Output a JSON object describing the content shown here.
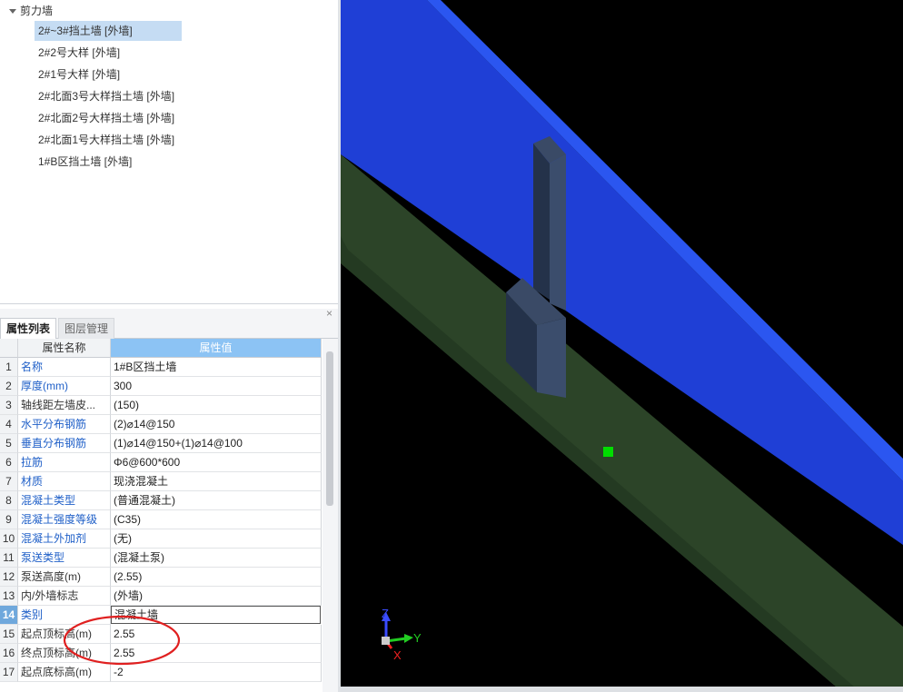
{
  "tree": {
    "root_label": "剪力墙",
    "items": [
      {
        "label": "2#~3#挡土墙 [外墙]",
        "selected": true
      },
      {
        "label": "2#2号大样 [外墙]",
        "selected": false
      },
      {
        "label": "2#1号大样 [外墙]",
        "selected": false
      },
      {
        "label": "2#北面3号大样挡土墙 [外墙]",
        "selected": false
      },
      {
        "label": "2#北面2号大样挡土墙 [外墙]",
        "selected": false
      },
      {
        "label": "2#北面1号大样挡土墙 [外墙]",
        "selected": false
      },
      {
        "label": "1#B区挡土墙 [外墙]",
        "selected": false
      }
    ]
  },
  "tabs": [
    {
      "label": "属性列表",
      "active": true
    },
    {
      "label": "图层管理",
      "active": false
    }
  ],
  "close_glyph": "×",
  "properties": {
    "header_name": "属性名称",
    "header_value": "属性值",
    "selected_row": 14,
    "rows": [
      {
        "num": "1",
        "name": "名称",
        "value": "1#B区挡土墙",
        "link": true
      },
      {
        "num": "2",
        "name": "厚度(mm)",
        "value": "300",
        "link": true
      },
      {
        "num": "3",
        "name": "轴线距左墙皮...",
        "value": "(150)",
        "link": false
      },
      {
        "num": "4",
        "name": "水平分布钢筋",
        "value": "(2)⌀14@150",
        "link": true
      },
      {
        "num": "5",
        "name": "垂直分布钢筋",
        "value": "(1)⌀14@150+(1)⌀14@100",
        "link": true
      },
      {
        "num": "6",
        "name": "拉筋",
        "value": "Φ6@600*600",
        "link": true
      },
      {
        "num": "7",
        "name": "材质",
        "value": "现浇混凝土",
        "link": true
      },
      {
        "num": "8",
        "name": "混凝土类型",
        "value": "(普通混凝土)",
        "link": true
      },
      {
        "num": "9",
        "name": "混凝土强度等级",
        "value": "(C35)",
        "link": true
      },
      {
        "num": "10",
        "name": "混凝土外加剂",
        "value": "(无)",
        "link": true
      },
      {
        "num": "11",
        "name": "泵送类型",
        "value": "(混凝土泵)",
        "link": true
      },
      {
        "num": "12",
        "name": "泵送高度(m)",
        "value": "(2.55)",
        "link": false
      },
      {
        "num": "13",
        "name": "内/外墙标志",
        "value": "(外墙)",
        "link": false
      },
      {
        "num": "14",
        "name": "类别",
        "value": "混凝土墙",
        "link": true
      },
      {
        "num": "15",
        "name": "起点顶标高(m)",
        "value": "2.55",
        "link": false
      },
      {
        "num": "16",
        "name": "终点顶标高(m)",
        "value": "2.55",
        "link": false
      },
      {
        "num": "17",
        "name": "起点底标高(m)",
        "value": "-2",
        "link": false
      }
    ]
  },
  "viewport": {
    "axes": {
      "z": "Z",
      "y": "Y",
      "x": "X"
    },
    "colors": {
      "background": "#000000",
      "wall": "#1f3fd6",
      "wall_top": "#2a52e8",
      "slab": "#2c4428",
      "column": "#2d3a52",
      "marker": "#00dd00",
      "annotation": "#e02020"
    }
  }
}
